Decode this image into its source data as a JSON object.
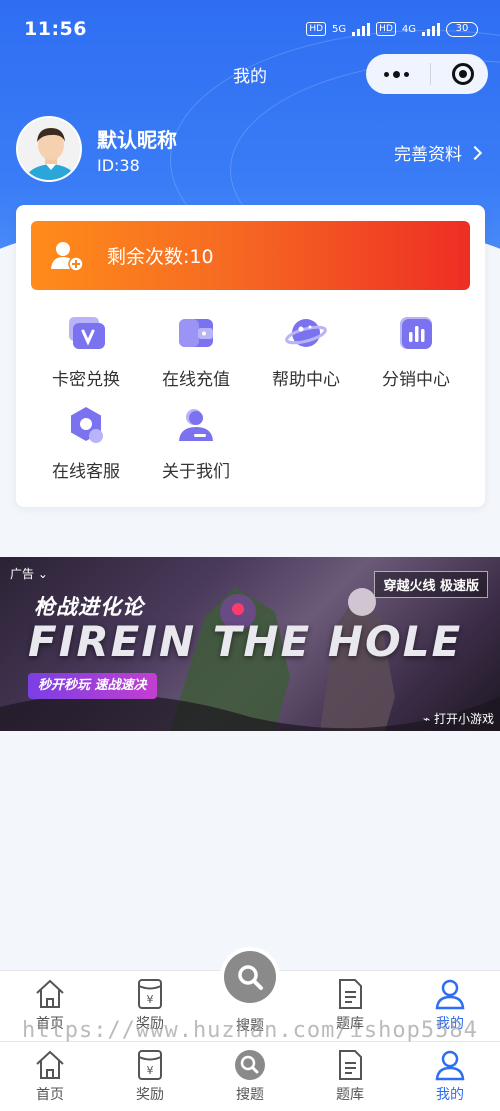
{
  "status": {
    "time": "11:56",
    "net1": "5G",
    "net2": "4G",
    "hd": "HD",
    "battery": "30"
  },
  "nav": {
    "title": "我的"
  },
  "profile": {
    "nickname": "默认昵称",
    "id": "ID:38",
    "complete_label": "完善资料"
  },
  "remain": {
    "text": "剩余次数:10"
  },
  "grid": [
    {
      "label": "卡密兑换",
      "icon": "card-redeem-icon"
    },
    {
      "label": "在线充值",
      "icon": "wallet-icon"
    },
    {
      "label": "帮助中心",
      "icon": "planet-icon"
    },
    {
      "label": "分销中心",
      "icon": "bar-chart-icon"
    },
    {
      "label": "在线客服",
      "icon": "service-icon"
    },
    {
      "label": "关于我们",
      "icon": "about-user-icon"
    }
  ],
  "ad": {
    "tag": "广告",
    "title": "枪战进化论",
    "big": "FIREIN THE HOLE",
    "pill": "秒开秒玩 速战速决",
    "brand": "穿越火线 极速版",
    "open": "打开小游戏"
  },
  "tabs_top": [
    {
      "label": "首页",
      "icon": "home-icon"
    },
    {
      "label": "奖励",
      "icon": "reward-icon"
    },
    {
      "label": "搜题",
      "icon": "search-icon"
    },
    {
      "label": "题库",
      "icon": "question-bank-icon"
    },
    {
      "label": "我的",
      "icon": "user-icon"
    }
  ],
  "tabs_bottom": [
    {
      "label": "首页",
      "icon": "home-icon"
    },
    {
      "label": "奖励",
      "icon": "reward-icon"
    },
    {
      "label": "搜题",
      "icon": "search-icon"
    },
    {
      "label": "题库",
      "icon": "question-bank-icon"
    },
    {
      "label": "我的",
      "icon": "user-icon"
    }
  ],
  "watermark": "https://www.huzhan.com/ishop5584",
  "colors": {
    "primary": "#2f6ef2",
    "gradient_start": "#ff8c1a",
    "gradient_end": "#ee2e24",
    "icon_purple": "#7b72f0"
  }
}
